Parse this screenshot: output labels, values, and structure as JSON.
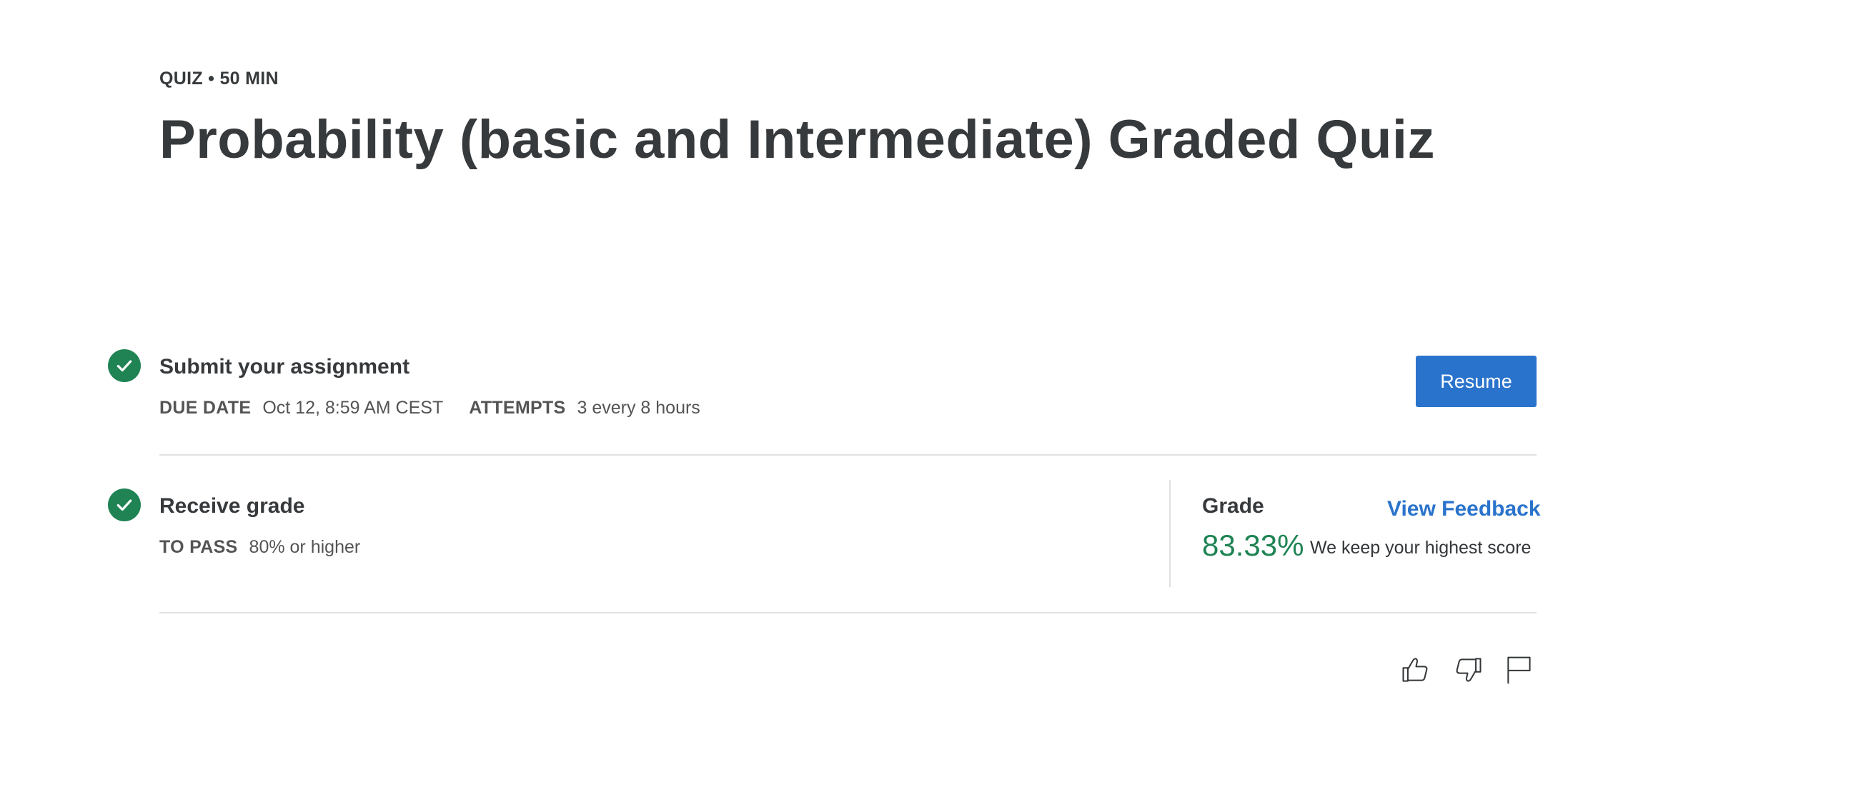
{
  "header": {
    "eyebrow": "QUIZ • 50 MIN",
    "title": "Probability (basic and Intermediate) Graded Quiz"
  },
  "submit": {
    "title": "Submit your assignment",
    "due_label": "DUE DATE",
    "due_value": "Oct 12, 8:59 AM CEST",
    "attempts_label": "ATTEMPTS",
    "attempts_value": "3 every 8 hours",
    "resume_label": "Resume"
  },
  "receive": {
    "title": "Receive grade",
    "to_pass_label": "TO PASS",
    "to_pass_value": "80% or higher"
  },
  "grade": {
    "label": "Grade",
    "feedback_link": "View Feedback",
    "value": "83.33%",
    "note": "We keep your highest score"
  },
  "actions": {
    "icons": [
      "thumbs-up-icon",
      "thumbs-down-icon",
      "flag-icon"
    ]
  },
  "colors": {
    "accent_blue": "#2a73cc",
    "success_green": "#1f8354",
    "text_dark": "#373a3c"
  }
}
